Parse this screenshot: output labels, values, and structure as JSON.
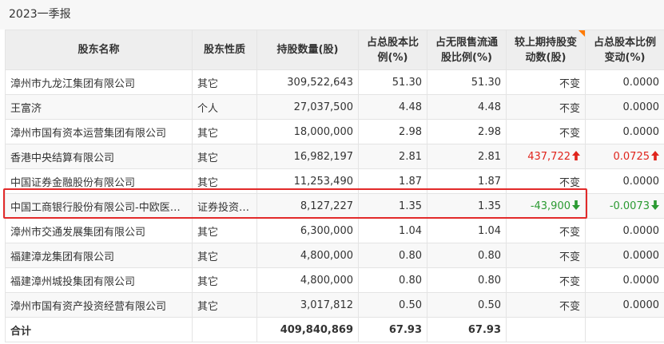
{
  "section_title": "2023一季报",
  "colors": {
    "up": "#e0251d",
    "down": "#2b9a32",
    "highlight": "#e22a2a",
    "header_bg": "#eeeeee",
    "corner_marker": "#ff7a00"
  },
  "headers": {
    "name": "股东名称",
    "type": "股东性质",
    "shares": "持股数量(股)",
    "total_ratio": "占总股本比例(%)",
    "float_ratio": "占无限售流通股比例(%)",
    "change_shares": "较上期持股变动数(股)",
    "change_ratio": "占总股本比例变动(%)"
  },
  "rows": [
    {
      "name": "漳州市九龙江集团有限公司",
      "type": "其它",
      "shares": "309,522,643",
      "total_ratio": "51.30",
      "float_ratio": "51.30",
      "change_shares": "不变",
      "change_ratio": "0.0000"
    },
    {
      "name": "王富济",
      "type": "个人",
      "shares": "27,037,500",
      "total_ratio": "4.48",
      "float_ratio": "4.48",
      "change_shares": "不变",
      "change_ratio": "0.0000"
    },
    {
      "name": "漳州市国有资本运营集团有限公司",
      "type": "其它",
      "shares": "18,000,000",
      "total_ratio": "2.98",
      "float_ratio": "2.98",
      "change_shares": "不变",
      "change_ratio": "0.0000"
    },
    {
      "name": "香港中央结算有限公司",
      "type": "其它",
      "shares": "16,982,197",
      "total_ratio": "2.81",
      "float_ratio": "2.81",
      "change_shares": "437,722",
      "change_ratio": "0.0725",
      "trend": "up",
      "arrow_icon": "arrow-up-icon"
    },
    {
      "name": "中国证券金融股份有限公司",
      "type": "其它",
      "shares": "11,253,490",
      "total_ratio": "1.87",
      "float_ratio": "1.87",
      "change_shares": "不变",
      "change_ratio": "0.0000"
    },
    {
      "name": "中国工商银行股份有限公司-中欧医疗健康混合型证券投资基金",
      "type": "证券投资基金",
      "shares": "8,127,227",
      "total_ratio": "1.35",
      "float_ratio": "1.35",
      "change_shares": "-43,900",
      "change_ratio": "-0.0073",
      "trend": "down",
      "arrow_icon": "arrow-down-icon"
    },
    {
      "name": "漳州市交通发展集团有限公司",
      "type": "其它",
      "shares": "6,300,000",
      "total_ratio": "1.04",
      "float_ratio": "1.04",
      "change_shares": "不变",
      "change_ratio": "0.0000"
    },
    {
      "name": "福建漳龙集团有限公司",
      "type": "其它",
      "shares": "4,800,000",
      "total_ratio": "0.80",
      "float_ratio": "0.80",
      "change_shares": "不变",
      "change_ratio": "0.0000"
    },
    {
      "name": "福建漳州城投集团有限公司",
      "type": "其它",
      "shares": "4,800,000",
      "total_ratio": "0.80",
      "float_ratio": "0.80",
      "change_shares": "不变",
      "change_ratio": "0.0000"
    },
    {
      "name": "漳州市国有资产投资经营有限公司",
      "type": "其它",
      "shares": "3,017,812",
      "total_ratio": "0.50",
      "float_ratio": "0.50",
      "change_shares": "不变",
      "change_ratio": "0.0000"
    }
  ],
  "total": {
    "label": "合计",
    "shares": "409,840,869",
    "total_ratio": "67.93",
    "float_ratio": "67.93"
  }
}
